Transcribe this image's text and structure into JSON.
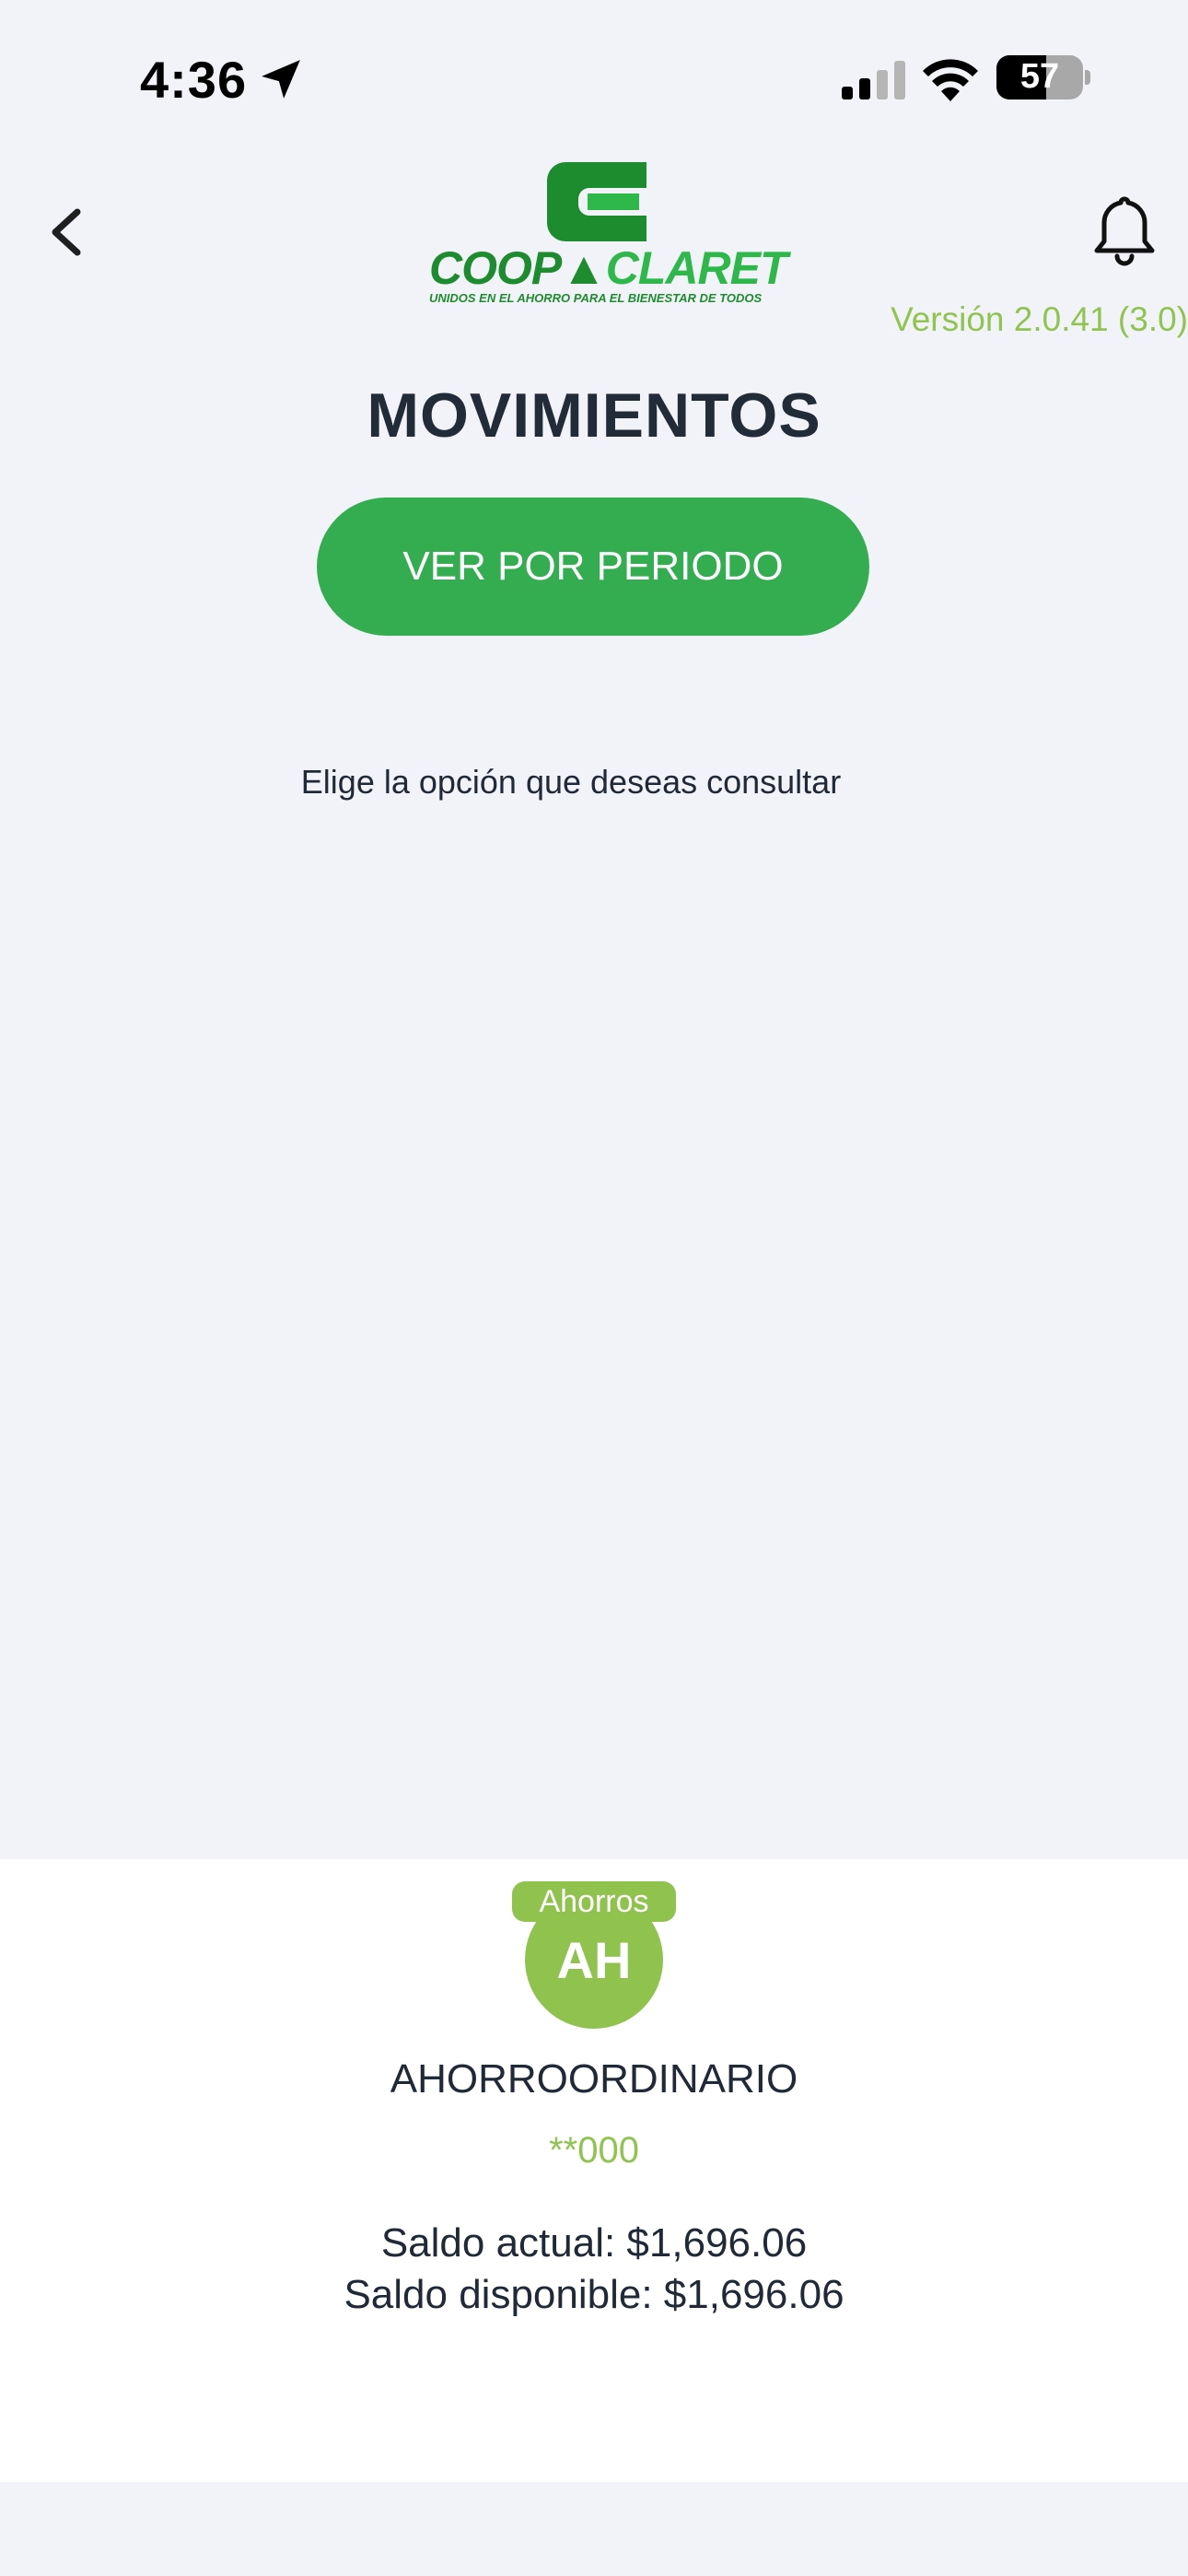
{
  "status_bar": {
    "time": "4:36",
    "battery_percent": "57",
    "battery_level": 0.57
  },
  "header": {
    "logo": {
      "brand_part1": "COOP",
      "brand_part2": "CLARET",
      "tagline": "UNIDOS EN EL AHORRO PARA EL BIENESTAR DE TODOS"
    },
    "version": "Versión 2.0.41 (3.0)"
  },
  "main": {
    "title": "MOVIMIENTOS",
    "period_button_label": "VER POR PERIODO",
    "hint": "Elige la opción que deseas consultar"
  },
  "account": {
    "type_badge": "Ahorros",
    "initials": "AH",
    "name": "AHORROORDINARIO",
    "number": "**000",
    "current_balance": "Saldo actual: $1,696.06",
    "available_balance": "Saldo disponible: $1,696.06"
  },
  "colors": {
    "primary_green": "#33ad4f",
    "accent_green": "#8fc54f",
    "background": "#f2f3f8",
    "title_text": "#222b38"
  },
  "icons": [
    "location-arrow-icon",
    "cellular-signal-icon",
    "wifi-icon",
    "battery-icon",
    "back-chevron-icon",
    "bell-icon"
  ]
}
